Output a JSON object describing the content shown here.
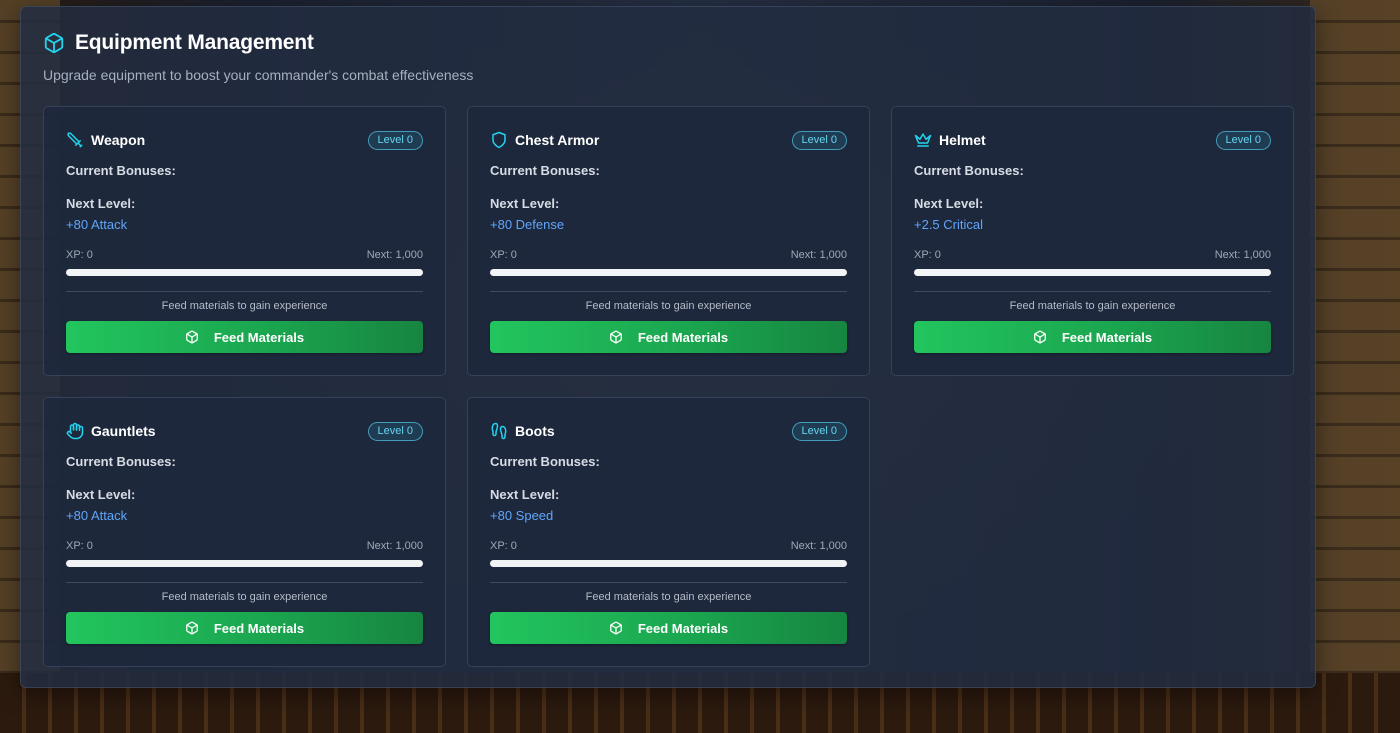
{
  "page": {
    "title": "Equipment Management",
    "title_icon": "cube-icon",
    "subtitle": "Upgrade equipment to boost your commander's combat effectiveness"
  },
  "labels": {
    "current_bonuses": "Current Bonuses:",
    "next_level": "Next Level:",
    "hint": "Feed materials to gain experience",
    "feed_button": "Feed Materials",
    "feed_button_icon": "cube-icon"
  },
  "colors": {
    "accent_cyan": "#22d3ee",
    "bonus_blue": "#60a5fa",
    "button_green": "#22c55e"
  },
  "equipment": [
    {
      "name": "Weapon",
      "icon": "sword-icon",
      "level": "Level 0",
      "next_bonus": "+80 Attack",
      "xp_text": "XP: 0",
      "next_text": "Next: 1,000",
      "xp_progress": 0
    },
    {
      "name": "Chest Armor",
      "icon": "shield-icon",
      "level": "Level 0",
      "next_bonus": "+80 Defense",
      "xp_text": "XP: 0",
      "next_text": "Next: 1,000",
      "xp_progress": 0
    },
    {
      "name": "Helmet",
      "icon": "crown-icon",
      "level": "Level 0",
      "next_bonus": "+2.5 Critical",
      "xp_text": "XP: 0",
      "next_text": "Next: 1,000",
      "xp_progress": 0
    },
    {
      "name": "Gauntlets",
      "icon": "hand-icon",
      "level": "Level 0",
      "next_bonus": "+80 Attack",
      "xp_text": "XP: 0",
      "next_text": "Next: 1,000",
      "xp_progress": 0
    },
    {
      "name": "Boots",
      "icon": "footprints-icon",
      "level": "Level 0",
      "next_bonus": "+80 Speed",
      "xp_text": "XP: 0",
      "next_text": "Next: 1,000",
      "xp_progress": 0
    }
  ]
}
